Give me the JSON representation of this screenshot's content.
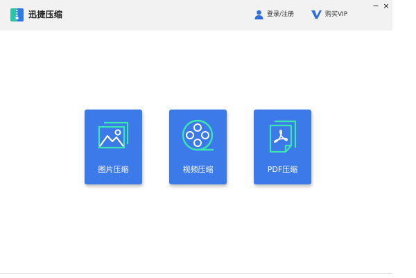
{
  "app": {
    "title": "迅捷压缩",
    "logo_icon": "zip-file-icon",
    "logo_colors": {
      "left": "#2ec4a6",
      "right": "#2d7be5",
      "zipper": "#ffffff"
    }
  },
  "header": {
    "login_label": "登录/注册",
    "login_icon": "user-icon",
    "vip_label": "购买VIP",
    "vip_icon": "vip-v-icon",
    "accent": "#2d6fd6"
  },
  "window_controls": {
    "minimize": "−",
    "close": "×"
  },
  "cards": [
    {
      "id": "image",
      "label": "图片压缩",
      "icon": "image-icon"
    },
    {
      "id": "video",
      "label": "视频压缩",
      "icon": "film-reel-icon"
    },
    {
      "id": "pdf",
      "label": "PDF压缩",
      "icon": "pdf-file-icon"
    }
  ],
  "colors": {
    "card_bg": "#3b7ae8",
    "icon_line": "#3be6b0",
    "titlebar_bg": "#f2f2f2"
  }
}
